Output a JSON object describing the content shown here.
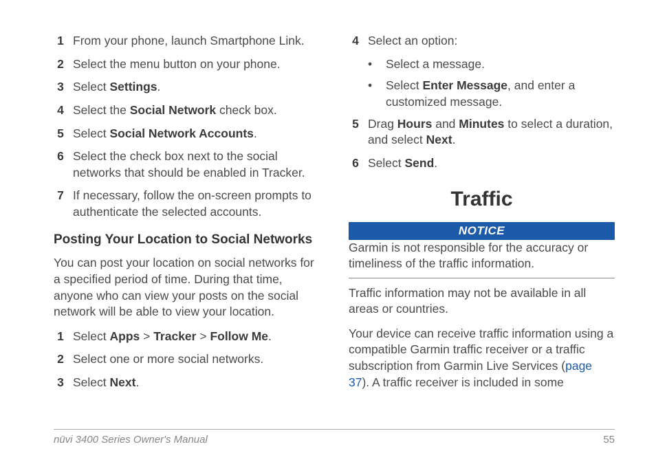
{
  "left": {
    "steps1": [
      {
        "n": "1",
        "html": "From your phone, launch Smartphone Link."
      },
      {
        "n": "2",
        "html": "Select the menu button on your phone."
      },
      {
        "n": "3",
        "html": "Select <b>Settings</b>."
      },
      {
        "n": "4",
        "html": "Select the <b>Social Network</b> check box."
      },
      {
        "n": "5",
        "html": "Select <b>Social Network Accounts</b>."
      },
      {
        "n": "6",
        "html": "Select the check box next to the social networks that should be enabled in Tracker."
      },
      {
        "n": "7",
        "html": "If necessary, follow the on-screen prompts to authenticate the selected accounts."
      }
    ],
    "subhead": "Posting Your Location to Social Networks",
    "intro": "You can post your location on social networks for a specified period of time. During that time, anyone who can view your posts on the social network will be able to view your location.",
    "steps2": [
      {
        "n": "1",
        "html": "Select <b>Apps</b> > <b>Tracker</b> > <b>Follow Me</b>."
      },
      {
        "n": "2",
        "html": "Select one or more social networks."
      },
      {
        "n": "3",
        "html": "Select <b>Next</b>."
      }
    ]
  },
  "right": {
    "step4": {
      "n": "4",
      "html": "Select an option:"
    },
    "bullets": [
      {
        "html": "Select a message."
      },
      {
        "html": "Select <b>Enter Message</b>, and enter a customized message."
      }
    ],
    "step5": {
      "n": "5",
      "html": "Drag <b>Hours</b> and <b>Minutes</b> to select a duration, and select <b>Next</b>."
    },
    "step6": {
      "n": "6",
      "html": "Select <b>Send</b>."
    },
    "chapter": "Traffic",
    "notice_label": "NOTICE",
    "notice_text": "Garmin is not responsible for the accuracy or timeliness of the traffic information.",
    "para1": "Traffic information may not be available in all areas or countries.",
    "para2_pre": "Your device can receive traffic information using a compatible Garmin traffic receiver or a traffic subscription from Garmin Live Services (",
    "para2_link": "page 37",
    "para2_post": "). A traffic receiver is included in some"
  },
  "footer": {
    "title": "nüvi 3400 Series Owner's Manual",
    "page": "55"
  }
}
